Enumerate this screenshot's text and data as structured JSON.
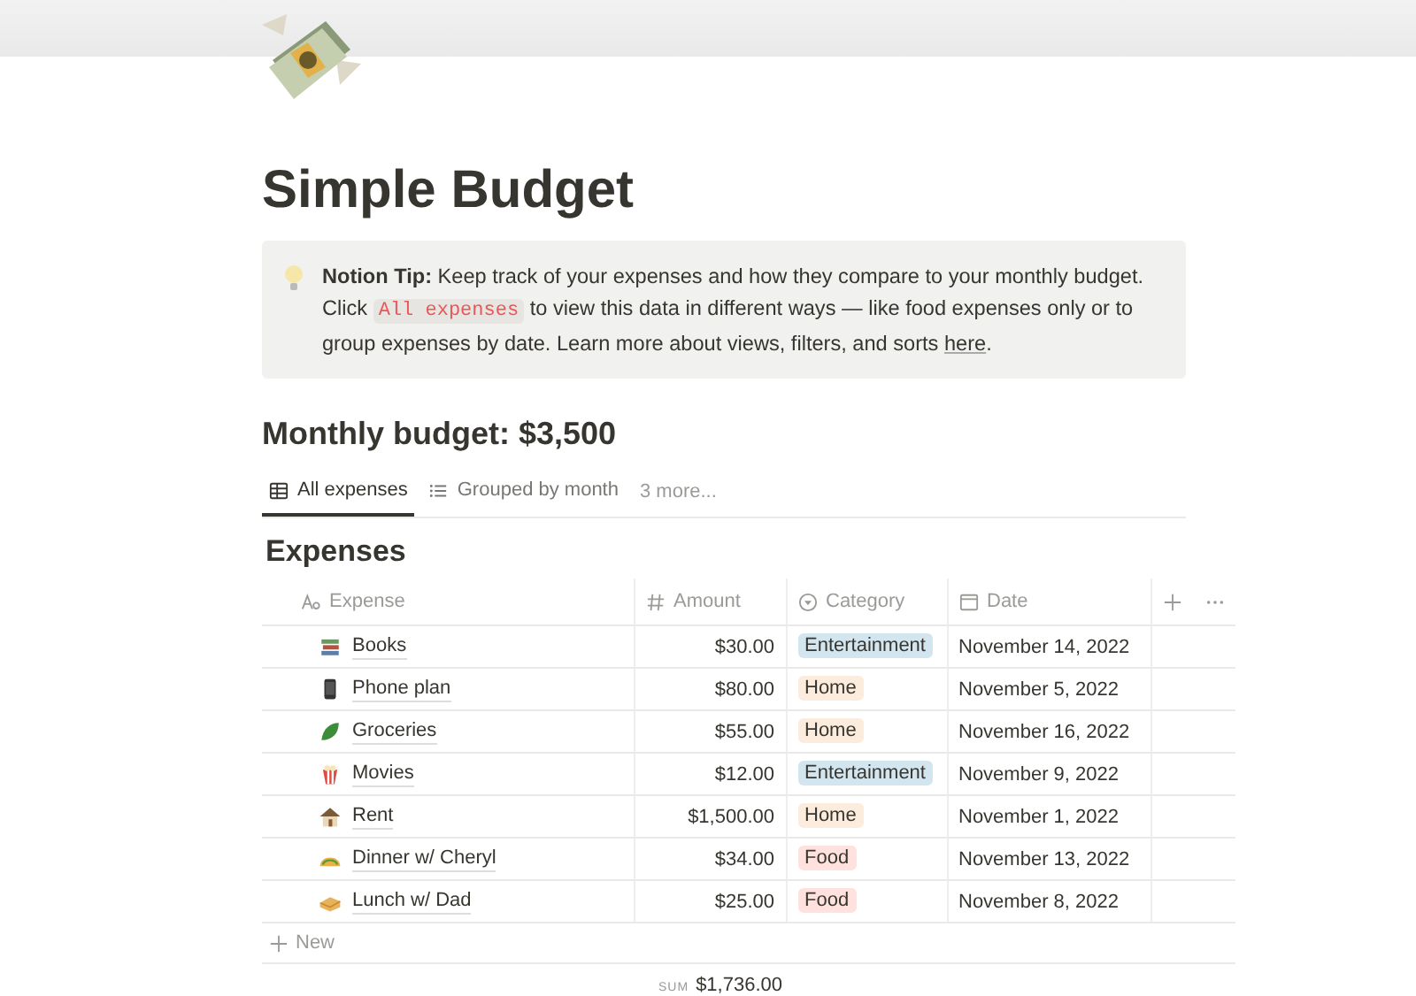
{
  "page": {
    "title": "Simple Budget"
  },
  "callout": {
    "text": "**Notion Tip:** Keep track of your expenses and how they compare to your monthly budget. Click ",
    "code": "All expenses",
    "text_after": " to view this data in different ways — like food expenses only or to group expenses by date. Learn more about views, filters, and sorts ",
    "link": "here",
    "end": "."
  },
  "budget_heading": "Monthly budget: $3,500",
  "views": [
    {
      "label": "All expenses",
      "kind": "table",
      "selected": true
    },
    {
      "label": "Grouped by month",
      "kind": "list",
      "selected": false
    }
  ],
  "more_views": "3 more...",
  "table": {
    "title": "Expenses",
    "columns": [
      {
        "label": "Expense",
        "kind": "title"
      },
      {
        "label": "Amount",
        "kind": "number"
      },
      {
        "label": "Category",
        "kind": "select"
      },
      {
        "label": "Date",
        "kind": "date"
      }
    ],
    "rows": [
      {
        "expense": "Books",
        "amount": "$30.00",
        "category": {
          "label": "Entertainment",
          "color": "#d3e5ef"
        },
        "date": "November 14, 2022"
      },
      {
        "expense": "Phone plan",
        "amount": "$80.00",
        "category": {
          "label": "Home",
          "color": "#fbecdd"
        },
        "date": "November 5, 2022"
      },
      {
        "expense": "Groceries",
        "amount": "$55.00",
        "category": {
          "label": "Home",
          "color": "#fbecdd"
        },
        "date": "November 16, 2022"
      },
      {
        "expense": "Movies",
        "amount": "$12.00",
        "category": {
          "label": "Entertainment",
          "color": "#d3e5ef"
        },
        "date": "November 9, 2022"
      },
      {
        "expense": "Rent",
        "amount": "$1,500.00",
        "category": {
          "label": "Home",
          "color": "#fbecdd"
        },
        "date": "November 1, 2022"
      },
      {
        "expense": "Dinner w/ Cheryl",
        "amount": "$34.00",
        "category": {
          "label": "Food",
          "color": "#ffe2dd"
        },
        "date": "November 13, 2022"
      },
      {
        "expense": "Lunch w/ Dad",
        "amount": "$25.00",
        "category": {
          "label": "Food",
          "color": "#ffe2dd"
        },
        "date": "November 8, 2022"
      }
    ],
    "new_label": "New",
    "sum_label": "SUM",
    "sum_value": "$1,736.00"
  }
}
